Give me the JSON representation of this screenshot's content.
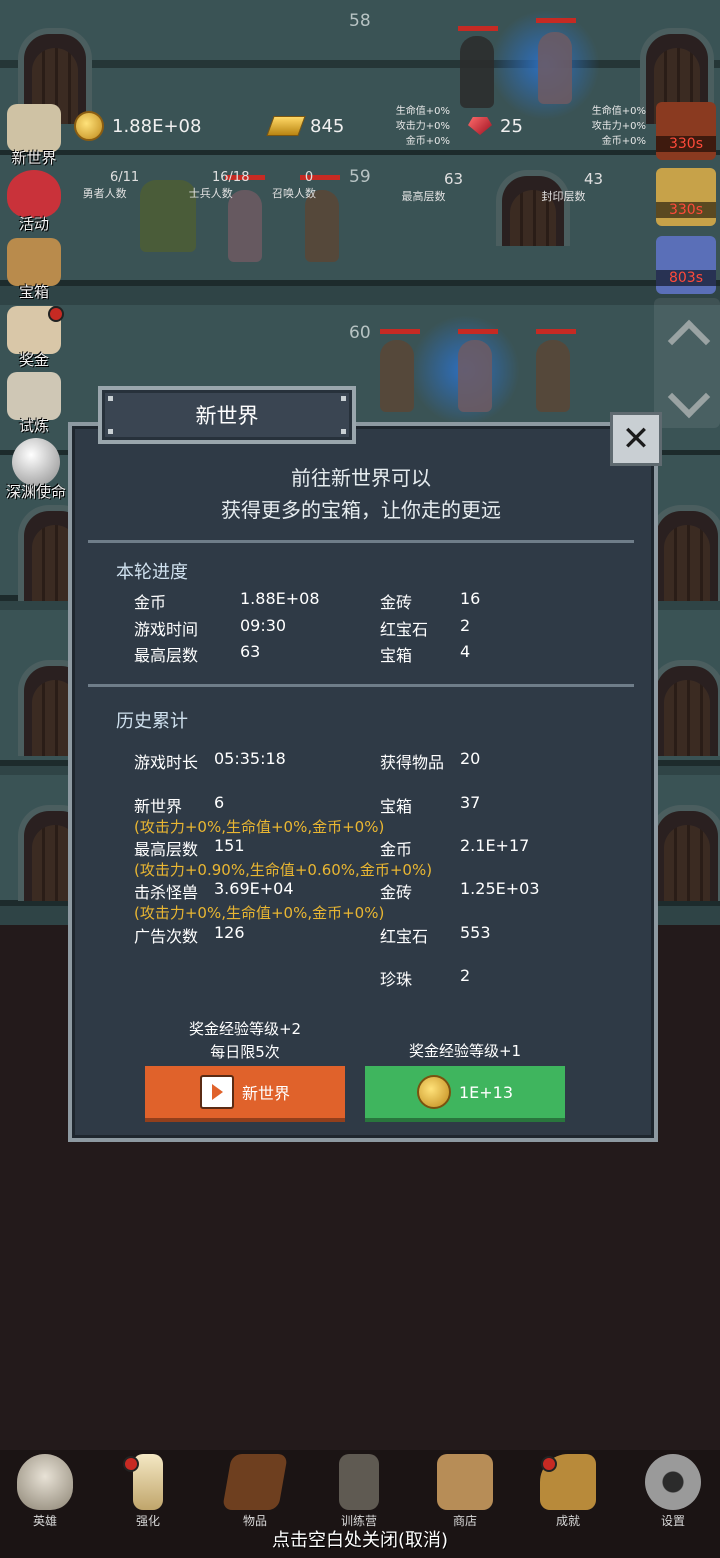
{
  "game": {
    "floors": [
      "58",
      "59",
      "60"
    ],
    "resources": {
      "gold": "1.88E+08",
      "gold_bars": "845",
      "rubies": "25",
      "bonus_left": [
        "生命值+0%",
        "攻击力+0%",
        "金币+0%"
      ],
      "bonus_right": [
        "生命值+0%",
        "攻击力+0%",
        "金币+0%"
      ]
    },
    "stats": [
      {
        "value": "6/11",
        "label": "勇者人数"
      },
      {
        "value": "16/18",
        "label": "士兵人数"
      },
      {
        "value": "0",
        "label": "召唤人数"
      },
      {
        "value": "63",
        "label": "最高层数"
      },
      {
        "value": "43",
        "label": "封印层数"
      }
    ]
  },
  "side_menu": [
    {
      "label": "新世界"
    },
    {
      "label": "活动"
    },
    {
      "label": "宝箱"
    },
    {
      "label": "奖金"
    },
    {
      "label": "试炼"
    },
    {
      "label": "深渊使命"
    }
  ],
  "timers": [
    "330s",
    "330s",
    "803s"
  ],
  "dialog": {
    "title": "新世界",
    "close_icon": "close-x",
    "intro_line1": "前往新世界可以",
    "intro_line2": "获得更多的宝箱，让你走的更远",
    "current": {
      "title": "本轮进度",
      "rows": [
        {
          "label": "金币",
          "value": "1.88E+08"
        },
        {
          "label": "游戏时间",
          "value": "09:30"
        },
        {
          "label": "最高层数",
          "value": "63"
        },
        {
          "label": "金砖",
          "value": "16"
        },
        {
          "label": "红宝石",
          "value": "2"
        },
        {
          "label": "宝箱",
          "value": "4"
        }
      ]
    },
    "history": {
      "title": "历史累计",
      "left": [
        {
          "label": "游戏时长",
          "value": "05:35:18"
        },
        {
          "label": "新世界",
          "value": "6"
        },
        {
          "label": "最高层数",
          "value": "151"
        },
        {
          "label": "击杀怪兽",
          "value": "3.69E+04"
        },
        {
          "label": "广告次数",
          "value": "126"
        }
      ],
      "right": [
        {
          "label": "获得物品",
          "value": "20"
        },
        {
          "label": "宝箱",
          "value": "37"
        },
        {
          "label": "金币",
          "value": "2.1E+17"
        },
        {
          "label": "金砖",
          "value": "1.25E+03"
        },
        {
          "label": "红宝石",
          "value": "553"
        },
        {
          "label": "珍珠",
          "value": "2"
        }
      ],
      "notes": [
        "(攻击力+0%,生命值+0%,金币+0%)",
        "(攻击力+0.90%,生命值+0.60%,金币+0%)",
        "(攻击力+0%,生命值+0%,金币+0%)"
      ]
    },
    "ad_option": {
      "caption1": "奖金经验等级+2",
      "caption2": "每日限5次",
      "button": "新世界"
    },
    "gold_option": {
      "caption": "奖金经验等级+1",
      "button": "1E+13"
    }
  },
  "bottom_nav": [
    {
      "label": "英雄",
      "icon": "skull-icon"
    },
    {
      "label": "强化",
      "icon": "candle-icon"
    },
    {
      "label": "物品",
      "icon": "book-icon"
    },
    {
      "label": "训练营",
      "icon": "lantern-icon"
    },
    {
      "label": "商店",
      "icon": "mug-icon"
    },
    {
      "label": "成就",
      "icon": "key-icon"
    },
    {
      "label": "设置",
      "icon": "gear-icon"
    }
  ],
  "close_hint": "点击空白处关闭(取消)",
  "colors": {
    "accent_orange": "#e0622b",
    "accent_green": "#3fb55e",
    "note_yellow": "#e9b632",
    "panel": "#2f3a46"
  }
}
